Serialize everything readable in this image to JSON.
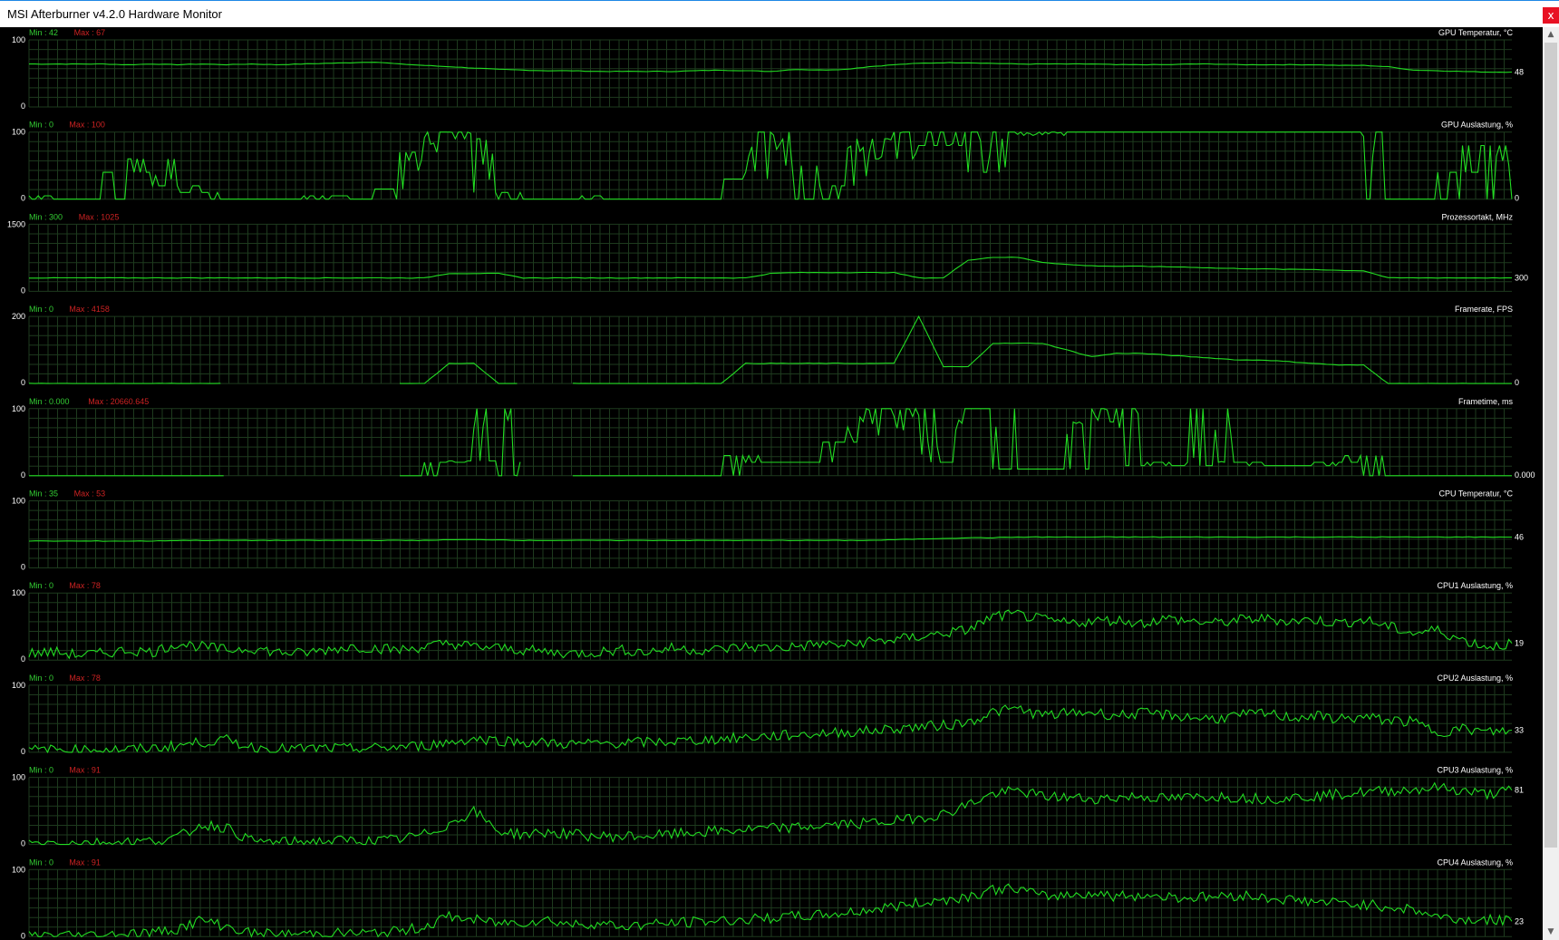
{
  "window": {
    "title": "MSI Afterburner v4.2.0 Hardware Monitor",
    "close_label": "x",
    "scroll_up": "▲",
    "scroll_down": "▼"
  },
  "colors": {
    "background": "#000000",
    "grid": "#1e3a1e",
    "trace": "#22dd22",
    "min_text": "#33cc33",
    "max_text": "#cc2222",
    "label_text": "#ffffff"
  },
  "chart_data": [
    {
      "type": "line",
      "title": "GPU Temperatur, °C",
      "min_label": "Min : 42",
      "max_label": "Max : 67",
      "y_top_label": "100",
      "y_bottom_label": "0",
      "current_label": "48",
      "ylim": [
        0,
        100
      ],
      "style": "smooth",
      "values": [
        64,
        64,
        64,
        64,
        63,
        64,
        63,
        64,
        63,
        64,
        63,
        64,
        65,
        66,
        67,
        64,
        62,
        60,
        58,
        56,
        55,
        54,
        54,
        53,
        53,
        53,
        53,
        54,
        55,
        54,
        53,
        56,
        55,
        56,
        60,
        63,
        65,
        66,
        66,
        65,
        64,
        64,
        64,
        64,
        63,
        63,
        63,
        64,
        64,
        63,
        63,
        63,
        63,
        62,
        62,
        60,
        55,
        54,
        53,
        52,
        52
      ]
    },
    {
      "type": "line",
      "title": "GPU Auslastung, %",
      "min_label": "Min : 0",
      "max_label": "Max : 100",
      "y_top_label": "100",
      "y_bottom_label": "0",
      "current_label": "0",
      "ylim": [
        0,
        100
      ],
      "style": "spiky",
      "values": [
        5,
        0,
        0,
        0,
        40,
        60,
        20,
        10,
        0,
        0,
        0,
        0,
        5,
        0,
        0,
        15,
        70,
        100,
        90,
        10,
        0,
        0,
        0,
        5,
        0,
        0,
        0,
        0,
        0,
        30,
        100,
        50,
        0,
        20,
        90,
        60,
        100,
        80,
        100,
        40,
        100,
        95,
        100,
        100,
        100,
        100,
        100,
        100,
        100,
        100,
        100,
        100,
        100,
        100,
        100,
        0,
        0,
        0,
        40,
        80,
        0
      ]
    },
    {
      "type": "line",
      "title": "Prozessortakt, MHz",
      "min_label": "Min : 300",
      "max_label": "Max : 1025",
      "y_top_label": "1500",
      "y_bottom_label": "0",
      "current_label": "300",
      "ylim": [
        0,
        1500
      ],
      "style": "smooth",
      "values": [
        300,
        300,
        300,
        300,
        300,
        300,
        300,
        300,
        300,
        300,
        300,
        300,
        300,
        300,
        300,
        300,
        300,
        400,
        400,
        400,
        300,
        300,
        300,
        300,
        300,
        300,
        300,
        300,
        300,
        300,
        400,
        420,
        420,
        420,
        420,
        420,
        300,
        300,
        700,
        760,
        760,
        650,
        600,
        570,
        560,
        560,
        550,
        540,
        520,
        510,
        500,
        490,
        490,
        470,
        460,
        300,
        300,
        300,
        300,
        300,
        300
      ]
    },
    {
      "type": "line",
      "title": "Framerate, FPS",
      "min_label": "Min : 0",
      "max_label": "Max : 4158",
      "y_top_label": "200",
      "y_bottom_label": "0",
      "current_label": "0",
      "ylim": [
        0,
        200
      ],
      "style": "smooth",
      "values": [
        0,
        0,
        0,
        0,
        0,
        0,
        0,
        0,
        0,
        null,
        null,
        null,
        null,
        null,
        null,
        0,
        0,
        60,
        60,
        0,
        0,
        null,
        0,
        0,
        0,
        0,
        0,
        0,
        0,
        60,
        60,
        60,
        60,
        60,
        60,
        60,
        200,
        50,
        50,
        120,
        120,
        120,
        100,
        80,
        90,
        90,
        85,
        80,
        75,
        70,
        70,
        65,
        60,
        55,
        55,
        0,
        0,
        0,
        0,
        0,
        0
      ]
    },
    {
      "type": "line",
      "title": "Frametime, ms",
      "min_label": "Min : 0.000",
      "max_label": "Max : 20660.645",
      "y_top_label": "100",
      "y_bottom_label": "0",
      "current_label": "0.000",
      "ylim": [
        0,
        100
      ],
      "style": "spiky",
      "values": [
        0,
        0,
        0,
        0,
        0,
        0,
        0,
        0,
        0,
        null,
        null,
        null,
        null,
        null,
        null,
        0,
        0,
        20,
        22,
        100,
        0,
        null,
        0,
        0,
        0,
        0,
        0,
        0,
        0,
        30,
        20,
        20,
        20,
        50,
        100,
        60,
        100,
        20,
        100,
        100,
        10,
        10,
        10,
        80,
        100,
        15,
        20,
        15,
        100,
        20,
        15,
        15,
        15,
        20,
        30,
        0,
        0,
        0,
        0,
        0,
        0
      ]
    },
    {
      "type": "line",
      "title": "CPU Temperatur, °C",
      "min_label": "Min : 35",
      "max_label": "Max : 53",
      "y_top_label": "100",
      "y_bottom_label": "0",
      "current_label": "46",
      "ylim": [
        0,
        100
      ],
      "style": "smooth",
      "values": [
        40,
        40,
        40,
        40,
        40,
        40,
        41,
        41,
        41,
        41,
        41,
        41,
        41,
        41,
        41,
        41,
        41,
        42,
        42,
        42,
        41,
        41,
        41,
        41,
        41,
        41,
        41,
        41,
        41,
        41,
        41,
        41,
        41,
        41,
        41,
        42,
        43,
        44,
        45,
        45,
        46,
        46,
        46,
        46,
        46,
        46,
        46,
        46,
        46,
        46,
        46,
        46,
        46,
        46,
        46,
        46,
        46,
        46,
        46,
        46,
        46
      ]
    },
    {
      "type": "line",
      "title": "CPU1 Auslastung, %",
      "min_label": "Min : 0",
      "max_label": "Max : 78",
      "y_top_label": "100",
      "y_bottom_label": "0",
      "current_label": "19",
      "ylim": [
        0,
        100
      ],
      "style": "noisy",
      "values": [
        10,
        12,
        8,
        10,
        15,
        12,
        25,
        20,
        15,
        18,
        12,
        10,
        15,
        20,
        18,
        15,
        20,
        25,
        20,
        18,
        15,
        12,
        10,
        12,
        15,
        12,
        18,
        15,
        16,
        20,
        18,
        20,
        24,
        22,
        28,
        30,
        35,
        40,
        45,
        65,
        68,
        60,
        55,
        58,
        60,
        55,
        62,
        58,
        55,
        60,
        62,
        58,
        60,
        55,
        60,
        50,
        40,
        45,
        30,
        20,
        25
      ]
    },
    {
      "type": "line",
      "title": "CPU2 Auslastung, %",
      "min_label": "Min : 0",
      "max_label": "Max : 78",
      "y_top_label": "100",
      "y_bottom_label": "0",
      "current_label": "33",
      "ylim": [
        0,
        100
      ],
      "style": "noisy",
      "values": [
        3,
        4,
        3,
        5,
        4,
        6,
        10,
        15,
        18,
        8,
        5,
        5,
        6,
        5,
        6,
        8,
        10,
        15,
        20,
        18,
        15,
        14,
        12,
        13,
        14,
        15,
        16,
        18,
        20,
        22,
        24,
        26,
        28,
        30,
        32,
        35,
        38,
        40,
        45,
        60,
        65,
        55,
        58,
        60,
        55,
        58,
        56,
        52,
        50,
        55,
        58,
        52,
        54,
        50,
        52,
        48,
        45,
        30,
        35,
        30,
        33
      ]
    },
    {
      "type": "line",
      "title": "CPU3 Auslastung, %",
      "min_label": "Min : 0",
      "max_label": "Max : 91",
      "y_top_label": "100",
      "y_bottom_label": "0",
      "current_label": "81",
      "ylim": [
        0,
        100
      ],
      "style": "noisy",
      "values": [
        2,
        3,
        2,
        3,
        4,
        5,
        10,
        30,
        25,
        5,
        3,
        4,
        5,
        6,
        5,
        8,
        15,
        30,
        50,
        20,
        15,
        18,
        15,
        12,
        12,
        13,
        15,
        18,
        20,
        22,
        24,
        25,
        28,
        30,
        32,
        35,
        40,
        45,
        60,
        75,
        80,
        72,
        70,
        68,
        70,
        72,
        68,
        70,
        72,
        70,
        68,
        70,
        72,
        75,
        78,
        80,
        82,
        85,
        80,
        75,
        81
      ]
    },
    {
      "type": "line",
      "title": "CPU4 Auslastung, %",
      "min_label": "Min : 0",
      "max_label": "Max : 91",
      "y_top_label": "100",
      "y_bottom_label": "0",
      "current_label": "23",
      "ylim": [
        0,
        100
      ],
      "style": "noisy",
      "values": [
        2,
        3,
        2,
        3,
        5,
        6,
        12,
        25,
        15,
        5,
        3,
        4,
        5,
        5,
        5,
        8,
        15,
        30,
        25,
        20,
        22,
        25,
        18,
        20,
        15,
        18,
        20,
        22,
        24,
        25,
        28,
        30,
        32,
        35,
        40,
        45,
        50,
        55,
        60,
        70,
        72,
        60,
        62,
        65,
        60,
        62,
        60,
        58,
        60,
        62,
        58,
        55,
        52,
        50,
        48,
        45,
        40,
        30,
        25,
        25,
        23
      ]
    }
  ]
}
